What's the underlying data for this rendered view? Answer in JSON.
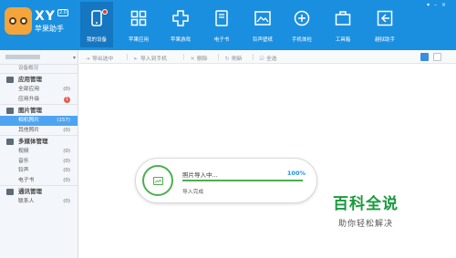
{
  "app": {
    "brand_title": "XY",
    "brand_version": "2.0",
    "brand_subtitle": "苹果助手"
  },
  "nav": [
    {
      "label": "我的设备",
      "icon": "phone-icon",
      "active": true
    },
    {
      "label": "苹果应用",
      "icon": "apps-grid-icon"
    },
    {
      "label": "苹果游戏",
      "icon": "gamepad-icon"
    },
    {
      "label": "电子书",
      "icon": "book-icon"
    },
    {
      "label": "铃声壁纸",
      "icon": "image-icon"
    },
    {
      "label": "手机体检",
      "icon": "plus-circle-icon"
    },
    {
      "label": "工具箱",
      "icon": "toolbox-icon"
    },
    {
      "label": "越狱助手",
      "icon": "unlock-icon"
    }
  ],
  "sidebar": {
    "top_faded": "设备概况",
    "sections": [
      {
        "title": "应用管理",
        "icon": "apps-icon",
        "items": [
          {
            "label": "全部应用",
            "count": "(0)"
          },
          {
            "label": "应用升级",
            "badge": "1"
          }
        ]
      },
      {
        "title": "图片管理",
        "icon": "picture-icon",
        "items": [
          {
            "label": "相机照片",
            "count": "(157)",
            "selected": true
          },
          {
            "label": "其他照片",
            "count": "(0)"
          }
        ]
      },
      {
        "title": "多媒体管理",
        "icon": "media-icon",
        "items": [
          {
            "label": "视频",
            "count": "(0)"
          },
          {
            "label": "音乐",
            "count": "(0)"
          },
          {
            "label": "铃声",
            "count": "(0)"
          },
          {
            "label": "电子书",
            "count": "(0)"
          }
        ]
      },
      {
        "title": "通讯管理",
        "icon": "contacts-icon",
        "items": [
          {
            "label": "联系人",
            "count": "(0)"
          }
        ]
      }
    ]
  },
  "toolbar": {
    "export_selected": "导出选中",
    "import_to_phone": "导入到手机",
    "delete": "删除",
    "refresh": "刷新",
    "select_all": "全选"
  },
  "progress": {
    "title": "照片导入中...",
    "percent_label": "100%",
    "fraction": 1.0,
    "status": "导入完成"
  },
  "watermark": {
    "title": "百科全说",
    "subtitle": "助你轻松解决"
  },
  "colors": {
    "header": "#1a8fe0",
    "accent_green": "#4caf50",
    "selected_row": "#4ea4f0",
    "badge_red": "#e45b4e"
  }
}
